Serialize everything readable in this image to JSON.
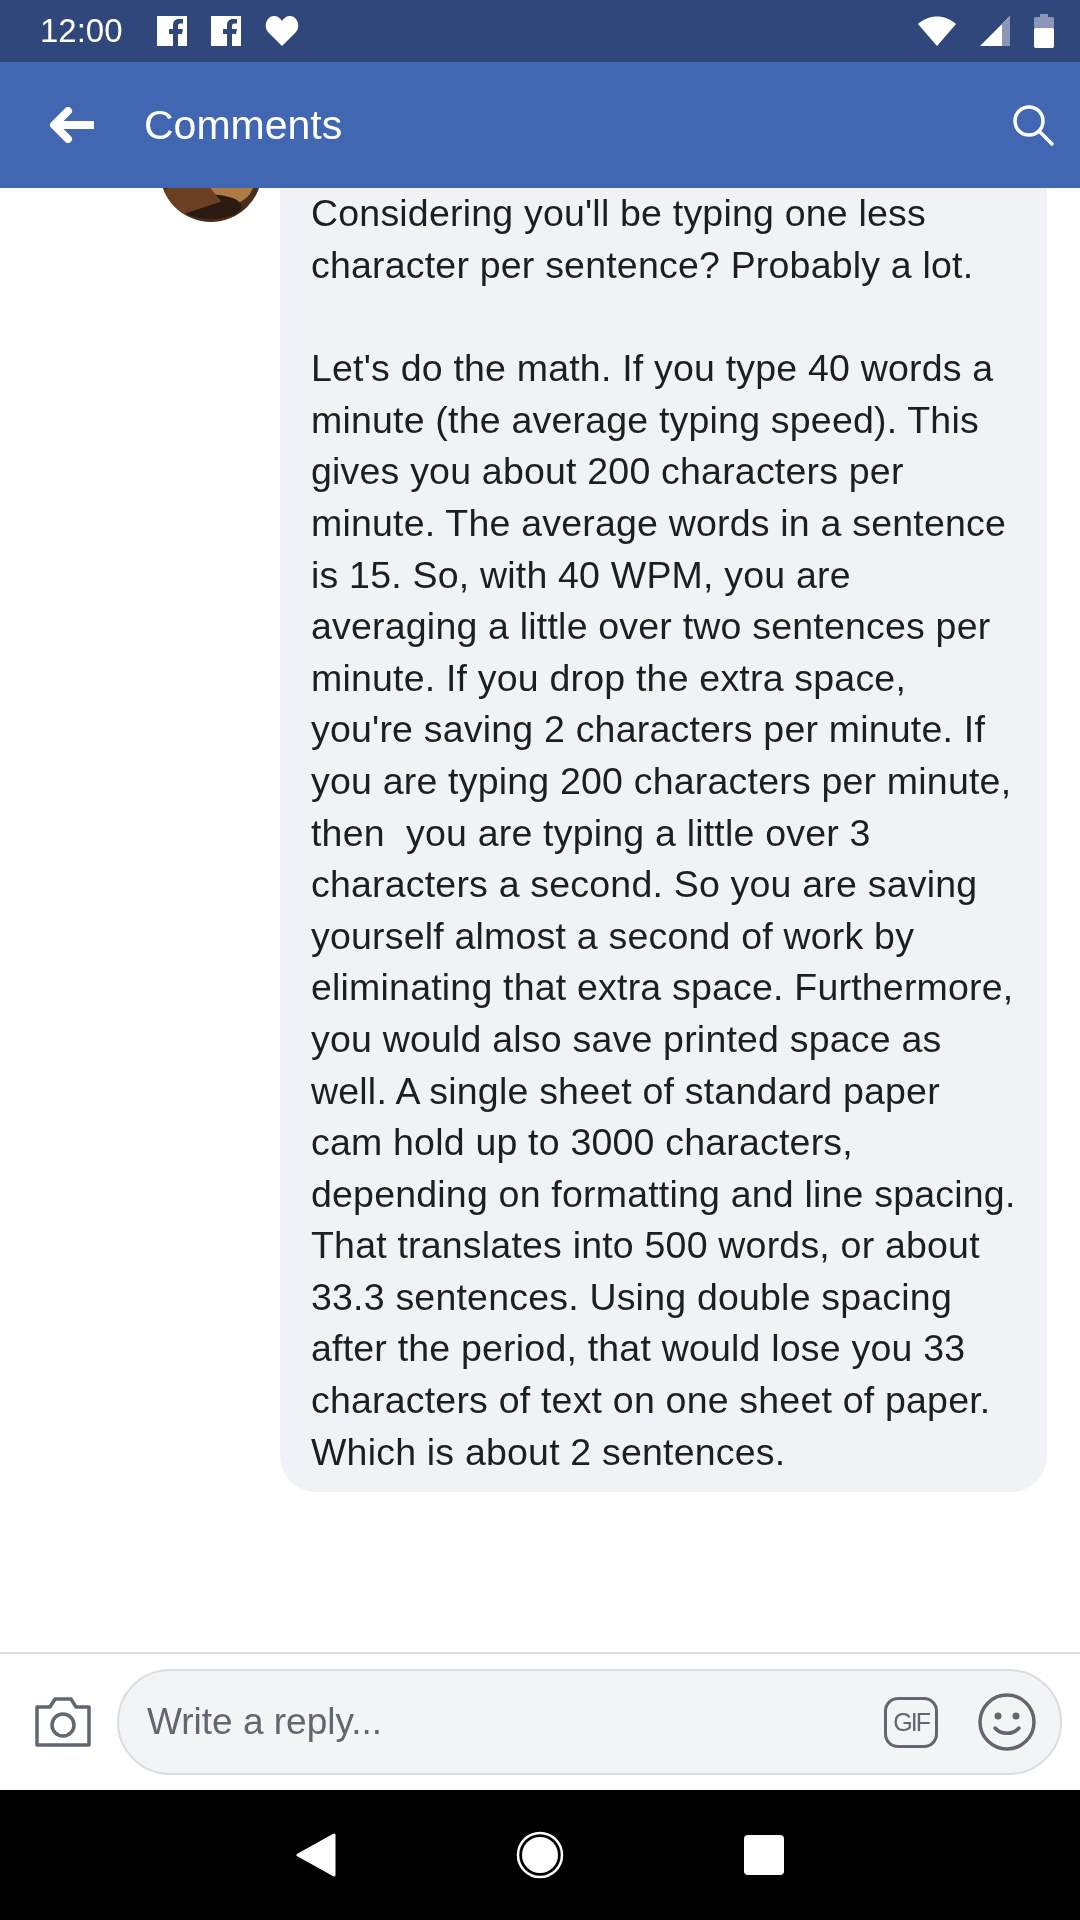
{
  "status_bar": {
    "time": "12:00"
  },
  "app_bar": {
    "title": "Comments"
  },
  "comment": {
    "paragraphs": [
      "Considering you'll be typing one less character per sentence? Probably a lot.",
      "Let's do the math. If you type 40 words a minute (the average typing speed). This gives you about 200 characters per minute. The average words in a sentence is 15. So, with 40 WPM, you are averaging a little over two sentences per minute. If you drop the extra space, you're saving 2 characters per minute. If you are typing 200 characters per minute, then  you are typing a little over 3 characters a second. So you are saving yourself almost a second of work by eliminating that extra space. Furthermore, you would also save printed space as well. A single sheet of standard paper cam hold up to 3000 characters, depending on formatting and line spacing. That translates into 500 words, or about 33.3 sentences. Using double spacing after the period, that would lose you 33 characters of text on one sheet of paper. Which is about 2 sentences."
    ]
  },
  "reply_bar": {
    "placeholder": "Write a reply...",
    "gif_label": "GIF"
  }
}
